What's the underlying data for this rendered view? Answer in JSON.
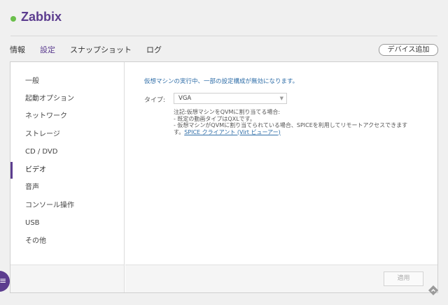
{
  "window": {
    "title": "Zabbix"
  },
  "tabs": [
    {
      "label": "情報"
    },
    {
      "label": "設定"
    },
    {
      "label": "スナップショット"
    },
    {
      "label": "ログ"
    }
  ],
  "toolbar": {
    "add_device_label": "デバイス追加"
  },
  "sidebar": {
    "items": [
      {
        "label": "一般"
      },
      {
        "label": "起動オプション"
      },
      {
        "label": "ネットワーク"
      },
      {
        "label": "ストレージ"
      },
      {
        "label": "CD / DVD"
      },
      {
        "label": "ビデオ"
      },
      {
        "label": "音声"
      },
      {
        "label": "コンソール操作"
      },
      {
        "label": "USB"
      },
      {
        "label": "その他"
      }
    ],
    "active_index": 5
  },
  "video": {
    "notice": "仮想マシンの実行中、一部の設定構成が無効になります。",
    "type_label": "タイプ:",
    "type_value": "VGA",
    "note_line1": "注記:仮想マシンをQVMに割り当てる場合:",
    "note_line2": "- 既定の動画タイプはQXLです。",
    "note_line3": "- 仮想マシンがQVMに割り当てられている場合、SPICEを利用してリモートアクセスできます",
    "note_line4_prefix": "す。",
    "spice_link": "SPICE クライアント (Virt ビューアー)"
  },
  "footer": {
    "apply_label": "適用"
  },
  "colors": {
    "accent": "#5c3d8f",
    "status": "#6abf4b",
    "link": "#2f6ea8"
  },
  "icons": {
    "menu": "hamburger-menu-icon",
    "corner": "diamond-arrow-icon",
    "dropdown": "chevron-down-icon"
  }
}
